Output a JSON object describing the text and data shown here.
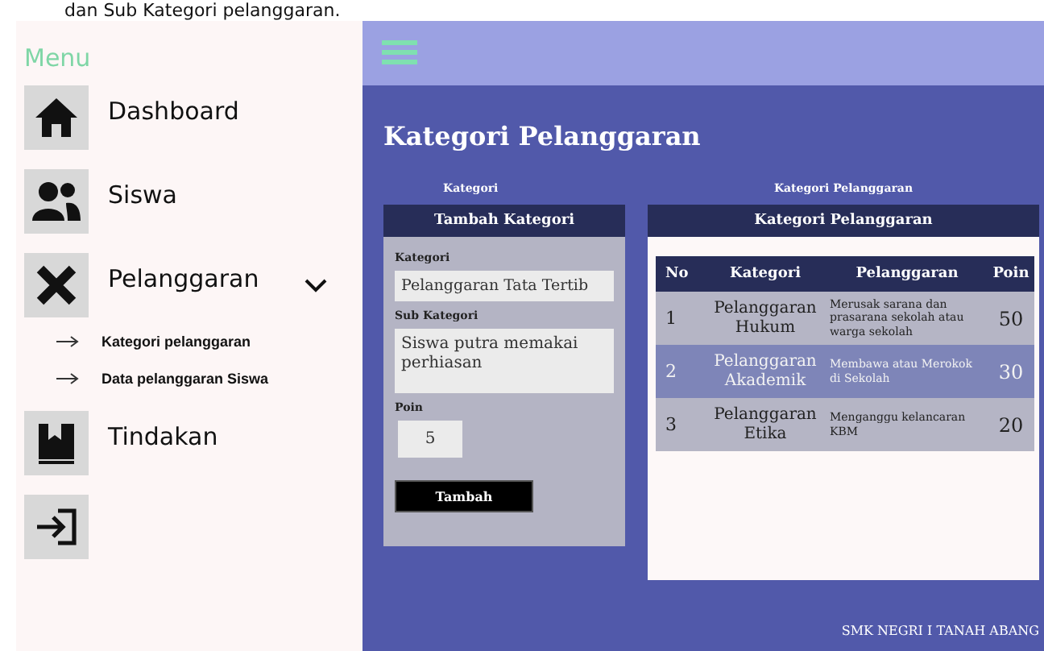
{
  "caption": "dan Sub Kategori pelanggaran.",
  "sidebar": {
    "title": "Menu",
    "items": [
      {
        "label": "Dashboard",
        "kind": "page"
      },
      {
        "label": "Siswa",
        "kind": "page"
      },
      {
        "label": "Pelanggaran",
        "kind": "page",
        "expanded": true,
        "children": [
          {
            "label": "Kategori pelanggaran"
          },
          {
            "label": "Data pelanggaran Siswa"
          }
        ]
      },
      {
        "label": "Tindakan",
        "kind": "page"
      },
      {
        "kind": "action"
      }
    ]
  },
  "page_title": "Kategori Pelanggaran",
  "section_labels": [
    "Kategori",
    "Kategori Pelanggaran"
  ],
  "form": {
    "title": "Tambah Kategori",
    "fields": [
      {
        "label": "Kategori",
        "value": "Pelanggaran Tata Tertib",
        "kind": "text"
      },
      {
        "label": "Sub Kategori",
        "value": "Siswa putra memakai perhiasan",
        "kind": "textarea"
      },
      {
        "label": "Poin",
        "value": "5",
        "kind": "short"
      }
    ],
    "button": "Tambah"
  },
  "table": {
    "title": "Kategori Pelanggaran",
    "columns": [
      "No",
      "Kategori",
      "Pelanggaran",
      "Poin"
    ],
    "rows": [
      {
        "cells": [
          "1",
          "Pelanggaran Hukum",
          "Merusak sarana dan prasarana sekolah atau warga sekolah",
          "50"
        ],
        "selected": false
      },
      {
        "cells": [
          "2",
          "Pelanggaran Akademik",
          "Membawa atau Merokok di Sekolah",
          "30"
        ],
        "selected": true
      },
      {
        "cells": [
          "3",
          "Pelanggaran Etika",
          "Menganggu kelancaran KBM",
          "20"
        ],
        "selected": false
      }
    ]
  },
  "footer": "SMK NEGRI I TANAH ABANG"
}
